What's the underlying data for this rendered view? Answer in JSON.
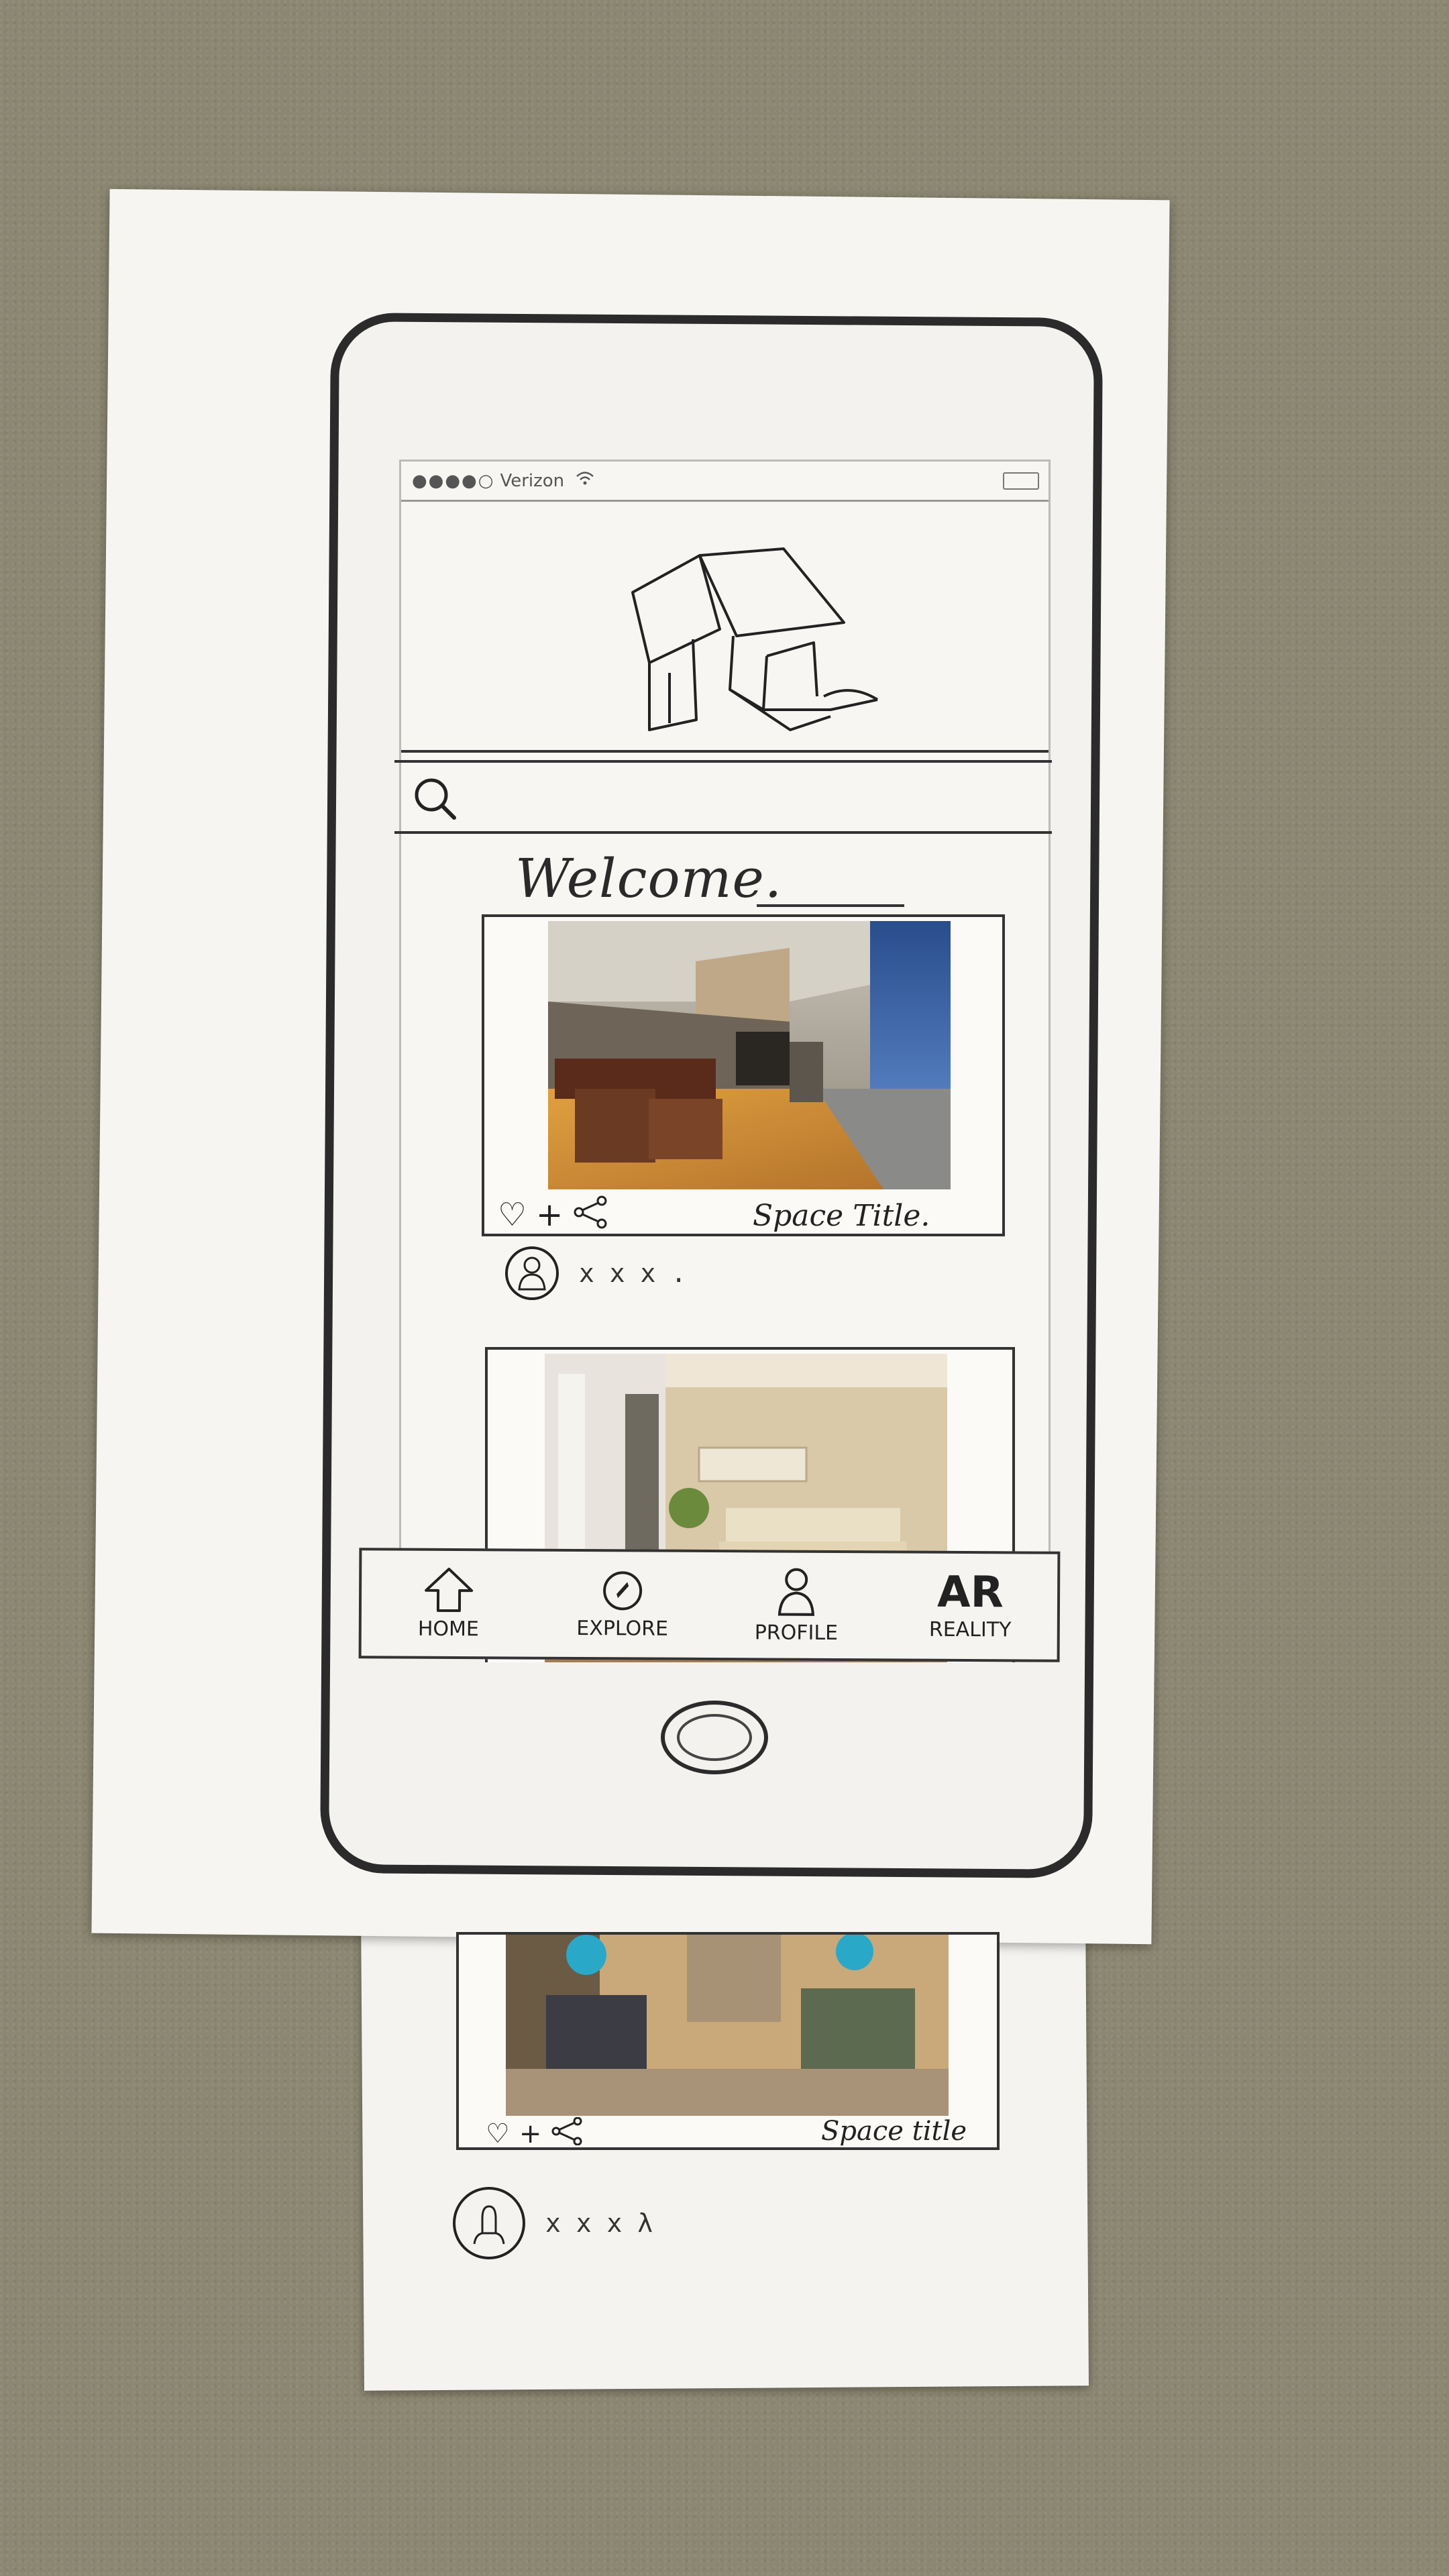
{
  "status_bar": {
    "carrier": "Verizon",
    "signal": "●●●●○"
  },
  "hero": {
    "logo_icon": "house-chair-sketch-icon"
  },
  "search": {
    "icon": "search-icon"
  },
  "welcome": {
    "text": "Welcome."
  },
  "feed": [
    {
      "title": "Space Title.",
      "author": "x x x ."
    },
    {
      "title": "",
      "author": ""
    },
    {
      "title": "Space title",
      "author": "x x x λ"
    }
  ],
  "tabbar": {
    "tabs": [
      {
        "label": "HOME",
        "icon": "home-icon"
      },
      {
        "label": "EXPLORE",
        "icon": "explore-icon"
      },
      {
        "label": "PROFILE",
        "icon": "profile-icon"
      },
      {
        "label": "REALITY",
        "icon": "ar-icon",
        "icon_text": "AR"
      }
    ]
  }
}
